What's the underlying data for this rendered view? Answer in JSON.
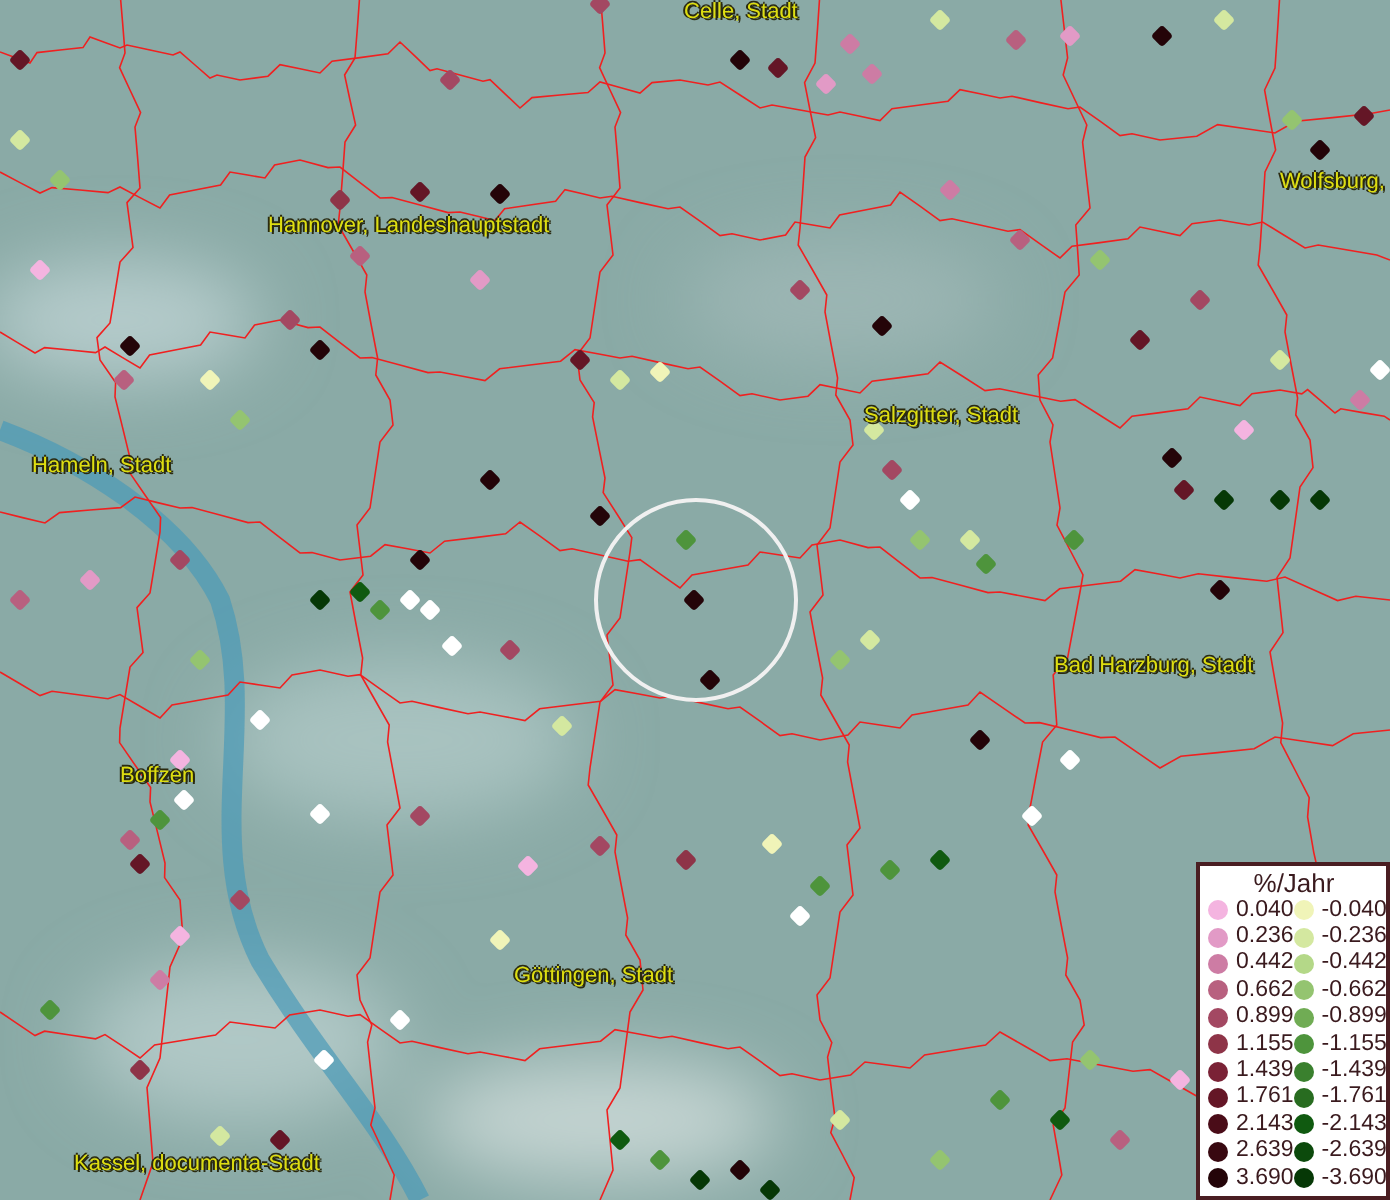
{
  "map": {
    "place_labels": [
      {
        "text": "Celle, Stadt"
      },
      {
        "text": "Wolfsburg,"
      },
      {
        "text": "Hannover, Landeshauptstadt"
      },
      {
        "text": "Hameln, Stadt"
      },
      {
        "text": "Salzgitter, Stadt"
      },
      {
        "text": "Bad Harzburg, Stadt"
      },
      {
        "text": "Boffzen"
      },
      {
        "text": "Göttingen, Stadt"
      },
      {
        "text": "Kassel, documenta-Stadt"
      }
    ]
  },
  "legend": {
    "title": "%/Jahr",
    "rows": [
      {
        "positive": {
          "label": "0.040",
          "color": "#f4b4e0"
        },
        "negative": {
          "label": "-0.040",
          "color": "#f0f4b8"
        }
      },
      {
        "positive": {
          "label": "0.236",
          "color": "#e29ac6"
        },
        "negative": {
          "label": "-0.236",
          "color": "#d4e8a0"
        }
      },
      {
        "positive": {
          "label": "0.442",
          "color": "#cd7ca4"
        },
        "negative": {
          "label": "-0.442",
          "color": "#b4d888"
        }
      },
      {
        "positive": {
          "label": "0.662",
          "color": "#b8607f"
        },
        "negative": {
          "label": "-0.662",
          "color": "#94c470"
        }
      },
      {
        "positive": {
          "label": "0.899",
          "color": "#a34862"
        },
        "negative": {
          "label": "-0.899",
          "color": "#70ac54"
        }
      },
      {
        "positive": {
          "label": "1.155",
          "color": "#8e3448"
        },
        "negative": {
          "label": "-1.155",
          "color": "#4e943c"
        }
      },
      {
        "positive": {
          "label": "1.439",
          "color": "#7a2236"
        },
        "negative": {
          "label": "-1.439",
          "color": "#3a802e"
        }
      },
      {
        "positive": {
          "label": "1.761",
          "color": "#641626"
        },
        "negative": {
          "label": "-1.761",
          "color": "#286c20"
        }
      },
      {
        "positive": {
          "label": "2.143",
          "color": "#4a0c18"
        },
        "negative": {
          "label": "-2.143",
          "color": "#105a10"
        }
      },
      {
        "positive": {
          "label": "2.639",
          "color": "#380810"
        },
        "negative": {
          "label": "-2.639",
          "color": "#0c4a0c"
        }
      },
      {
        "positive": {
          "label": "3.690",
          "color": "#240408"
        },
        "negative": {
          "label": "-3.690",
          "color": "#063806"
        }
      }
    ]
  }
}
